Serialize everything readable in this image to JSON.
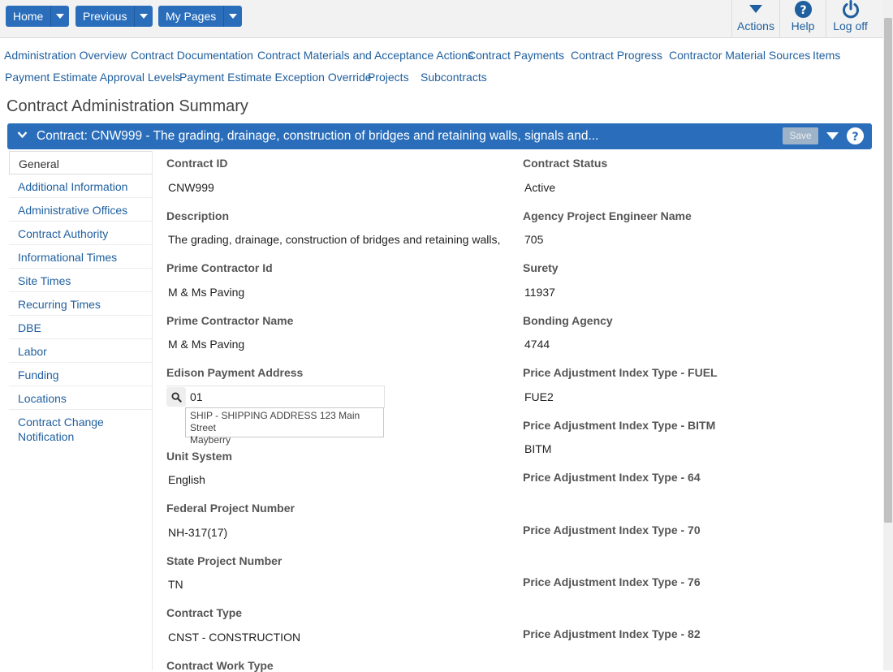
{
  "toolbar": {
    "home_label": "Home",
    "previous_label": "Previous",
    "mypages_label": "My Pages",
    "actions_label": "Actions",
    "help_label": "Help",
    "logoff_label": "Log off"
  },
  "nav_links": [
    "Administration Overview",
    "Contract Documentation",
    "Contract Materials and Acceptance Actions",
    "Contract Payments",
    "Contract Progress",
    "Contractor Material Sources",
    "Items",
    "Payment Estimate Approval Levels",
    "Payment Estimate Exception Override",
    "Projects",
    "Subcontracts"
  ],
  "page_title": "Contract Administration Summary",
  "panel": {
    "title": "Contract: CNW999 - The grading, drainage, construction of bridges and retaining walls, signals and...",
    "save_label": "Save"
  },
  "tabs": [
    "General",
    "Additional Information",
    "Administrative Offices",
    "Contract Authority",
    "Informational Times",
    "Site Times",
    "Recurring Times",
    "DBE",
    "Labor",
    "Funding",
    "Locations",
    "Contract Change Notification"
  ],
  "fields_left": [
    {
      "label": "Contract ID",
      "value": "CNW999"
    },
    {
      "label": "Description",
      "value": "The grading, drainage, construction of bridges and retaining walls, signals"
    },
    {
      "label": "Prime Contractor Id",
      "value": "M & Ms Paving"
    },
    {
      "label": "Prime Contractor Name",
      "value": "M & Ms Paving"
    },
    {
      "label": "Edison Payment Address",
      "value": ""
    },
    {
      "label": "Unit System",
      "value": "English"
    },
    {
      "label": "Federal Project Number",
      "value": "NH-317(17)"
    },
    {
      "label": "State Project Number",
      "value": "TN"
    },
    {
      "label": "Contract Type",
      "value": "CNST - CONSTRUCTION"
    },
    {
      "label": "Contract Work Type",
      "value": ""
    }
  ],
  "fields_right": [
    {
      "label": "Contract Status",
      "value": "Active"
    },
    {
      "label": "Agency Project Engineer Name",
      "value": "705"
    },
    {
      "label": "Surety",
      "value": "11937"
    },
    {
      "label": "Bonding Agency",
      "value": "4744"
    },
    {
      "label": "Price Adjustment Index Type - FUEL",
      "value": "FUE2"
    },
    {
      "label": "Price Adjustment Index Type - BITM",
      "value": "BITM"
    },
    {
      "label": "Price Adjustment Index Type - 64",
      "value": ""
    },
    {
      "label": "Price Adjustment Index Type - 70",
      "value": ""
    },
    {
      "label": "Price Adjustment Index Type - 76",
      "value": ""
    },
    {
      "label": "Price Adjustment Index Type - 82",
      "value": ""
    }
  ],
  "edison_lookup": {
    "input_value": "01",
    "suggestion_line1": "SHIP - SHIPPING ADDRESS 123 Main Street",
    "suggestion_line2": "Mayberry"
  },
  "colors": {
    "brand_blue": "#2a6ebb",
    "link_blue": "#1f5f9e"
  }
}
